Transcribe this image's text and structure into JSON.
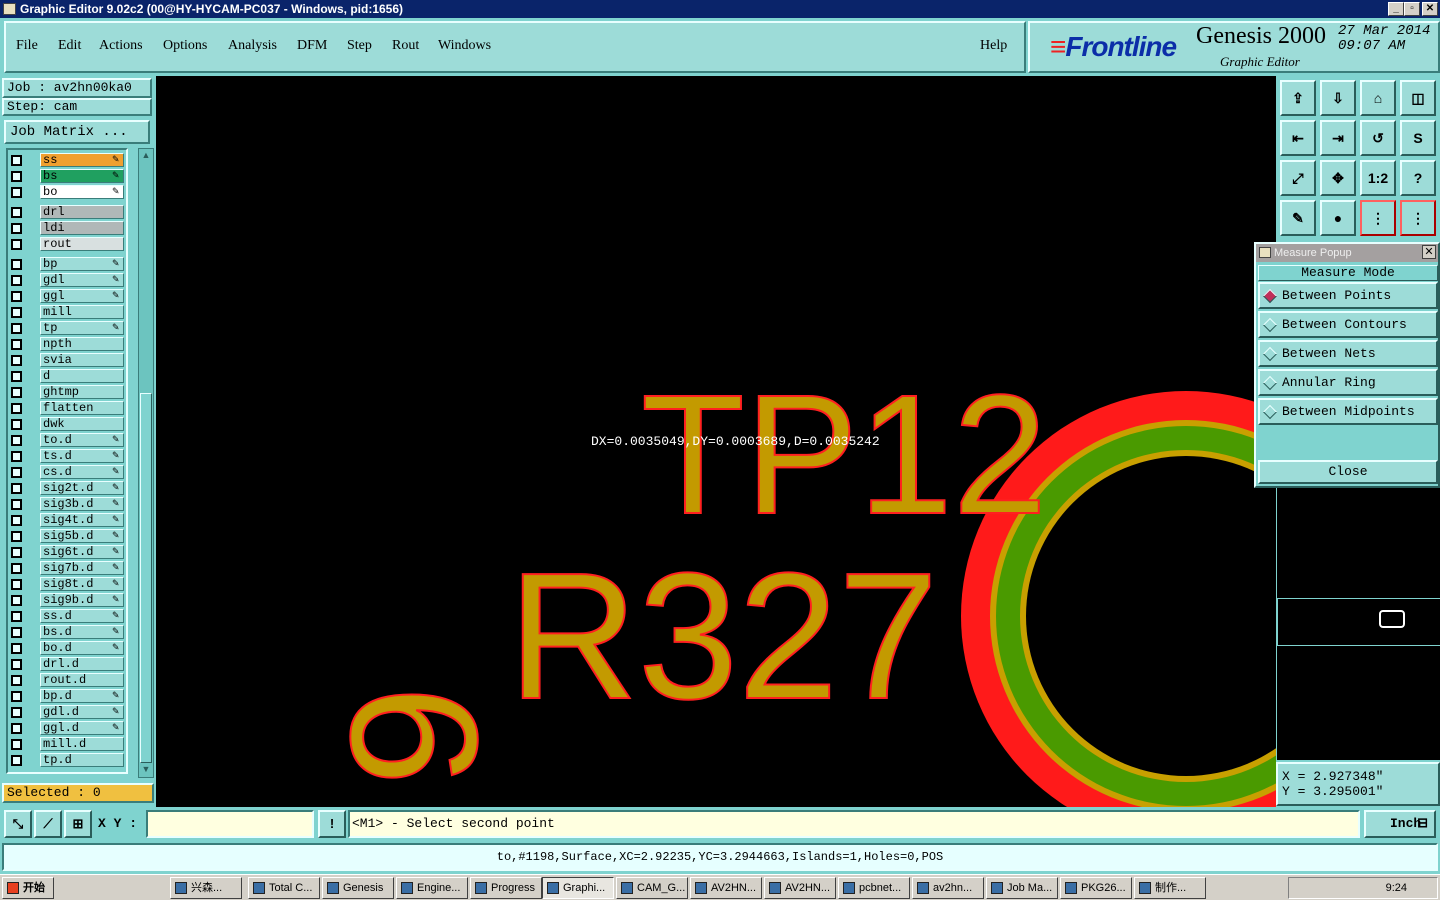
{
  "window": {
    "title": "Graphic Editor 9.02c2 (00@HY-HYCAM-PC037 - Windows, pid:1656)",
    "buttons": [
      "_",
      "▫",
      "✕"
    ]
  },
  "menu": {
    "items": [
      "File",
      "Edit",
      "Actions",
      "Options",
      "Analysis",
      "DFM",
      "Step",
      "Rout",
      "Windows"
    ],
    "help": "Help"
  },
  "brand": {
    "logo": "Frontline",
    "product": "Genesis 2000",
    "subtitle": "Graphic Editor",
    "date": "27 Mar 2014",
    "time": "09:07 AM"
  },
  "job": {
    "job_label": "Job : av2hn00ka0",
    "step_label": "Step: cam",
    "matrix_button": "Job Matrix ..."
  },
  "layers": [
    {
      "name": "ss",
      "color": "#f0a030",
      "pen": true
    },
    {
      "name": "bs",
      "color": "#20a060",
      "pen": true
    },
    {
      "name": "bo",
      "color": "#ffffff",
      "pen": true
    },
    {
      "name": "drl",
      "color": "#b0b8b8",
      "pen": false
    },
    {
      "name": "ldi",
      "color": "#b0b8b8",
      "pen": false
    },
    {
      "name": "rout",
      "color": "#d8e0e0",
      "pen": false
    },
    {
      "name": "bp",
      "color": "#9ddcd8",
      "pen": true
    },
    {
      "name": "gdl",
      "color": "#9ddcd8",
      "pen": true
    },
    {
      "name": "ggl",
      "color": "#9ddcd8",
      "pen": true
    },
    {
      "name": "mill",
      "color": "#9ddcd8",
      "pen": false
    },
    {
      "name": "tp",
      "color": "#9ddcd8",
      "pen": true
    },
    {
      "name": "npth",
      "color": "#9ddcd8",
      "pen": false
    },
    {
      "name": "svia",
      "color": "#9ddcd8",
      "pen": false
    },
    {
      "name": "d",
      "color": "#9ddcd8",
      "pen": false
    },
    {
      "name": "ghtmp",
      "color": "#9ddcd8",
      "pen": false
    },
    {
      "name": "flatten",
      "color": "#9ddcd8",
      "pen": false
    },
    {
      "name": "dwk",
      "color": "#9ddcd8",
      "pen": false
    },
    {
      "name": "to.d",
      "color": "#9ddcd8",
      "pen": true
    },
    {
      "name": "ts.d",
      "color": "#9ddcd8",
      "pen": true
    },
    {
      "name": "cs.d",
      "color": "#9ddcd8",
      "pen": true
    },
    {
      "name": "sig2t.d",
      "color": "#9ddcd8",
      "pen": true
    },
    {
      "name": "sig3b.d",
      "color": "#9ddcd8",
      "pen": true
    },
    {
      "name": "sig4t.d",
      "color": "#9ddcd8",
      "pen": true
    },
    {
      "name": "sig5b.d",
      "color": "#9ddcd8",
      "pen": true
    },
    {
      "name": "sig6t.d",
      "color": "#9ddcd8",
      "pen": true
    },
    {
      "name": "sig7b.d",
      "color": "#9ddcd8",
      "pen": true
    },
    {
      "name": "sig8t.d",
      "color": "#9ddcd8",
      "pen": true
    },
    {
      "name": "sig9b.d",
      "color": "#9ddcd8",
      "pen": true
    },
    {
      "name": "ss.d",
      "color": "#9ddcd8",
      "pen": true
    },
    {
      "name": "bs.d",
      "color": "#9ddcd8",
      "pen": true
    },
    {
      "name": "bo.d",
      "color": "#9ddcd8",
      "pen": true
    },
    {
      "name": "drl.d",
      "color": "#9ddcd8",
      "pen": false
    },
    {
      "name": "rout.d",
      "color": "#9ddcd8",
      "pen": false
    },
    {
      "name": "bp.d",
      "color": "#9ddcd8",
      "pen": true
    },
    {
      "name": "gdl.d",
      "color": "#9ddcd8",
      "pen": true
    },
    {
      "name": "ggl.d",
      "color": "#9ddcd8",
      "pen": true
    },
    {
      "name": "mill.d",
      "color": "#9ddcd8",
      "pen": false
    },
    {
      "name": "tp.d",
      "color": "#9ddcd8",
      "pen": false
    }
  ],
  "selected": "Selected : 0",
  "canvas": {
    "measure_text": "DX=0.0035049,DY=0.0003689,D=0.0035242",
    "label_tp": "TP12",
    "label_r": "R327",
    "label_9": "9"
  },
  "tools": [
    "⇪",
    "⇩",
    "⌂",
    "◫",
    "⇤",
    "⇥",
    "↺",
    "S",
    "⤢",
    "✥",
    "1:2",
    "?",
    "✎",
    "●",
    "⋮",
    "⋮"
  ],
  "measure_popup": {
    "title": "Measure Popup",
    "mode_label": "Measure Mode",
    "options": [
      "Between Points",
      "Between Contours",
      "Between Nets",
      "Annular Ring",
      "Between Midpoints"
    ],
    "selected_index": 0,
    "close": "Close"
  },
  "coords": {
    "x": "X = 2.927348\"",
    "y": "Y = 3.295001\""
  },
  "bottom": {
    "xy_label": "X Y :",
    "xy_value": "",
    "prompt": "<M1> - Select second point",
    "unit": "Inch"
  },
  "status": "to,#1198,Surface,XC=2.92235,YC=3.2944663,Islands=1,Holes=0,POS",
  "taskbar": {
    "start": "开始",
    "tasks": [
      "兴森...",
      "Total C...",
      "Genesis",
      "Engine...",
      "Progress",
      "Graphi...",
      "CAM_G...",
      "AV2HN...",
      "AV2HN...",
      "pcbnet...",
      "av2hn...",
      "Job Ma...",
      "PKG26...",
      "制作..."
    ],
    "active_index": 5,
    "clock": "9:24"
  }
}
